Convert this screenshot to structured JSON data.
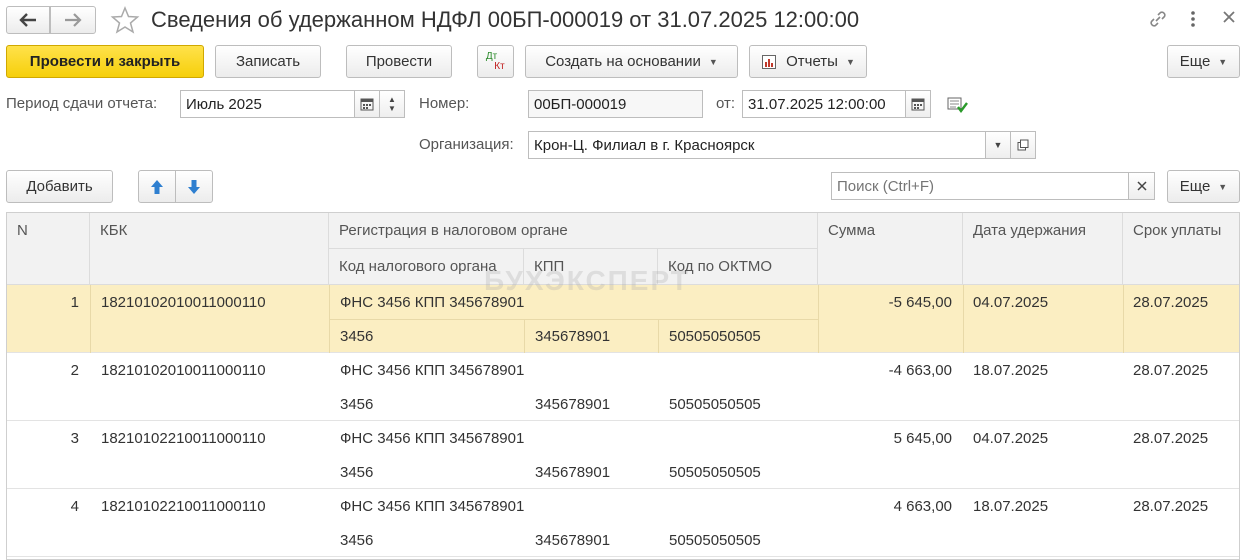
{
  "window": {
    "title": "Сведения об удержанном НДФЛ 00БП-000019 от 31.07.2025 12:00:00",
    "back_icon": "arrow-left-icon",
    "forward_icon": "arrow-right-icon",
    "star_icon": "star-icon",
    "link_icon": "link-icon",
    "menu_icon": "more-vertical-icon",
    "close_icon": "close-icon"
  },
  "toolbar": {
    "post_close": "Провести и закрыть",
    "save": "Записать",
    "post": "Провести",
    "dt_top": "Дт",
    "dt_bottom": "Кт",
    "create_basis": "Создать на основании",
    "reports": "Отчеты",
    "more": "Еще"
  },
  "form": {
    "period_label": "Период сдачи отчета:",
    "period_value": "Июль 2025",
    "number_label": "Номер:",
    "number_value": "00БП-000019",
    "date_label": "от:",
    "date_value": "31.07.2025 12:00:00",
    "org_label": "Организация:",
    "org_value": "Крон-Ц. Филиал в г. Красноярск"
  },
  "table_toolbar": {
    "add": "Добавить",
    "search_placeholder": "Поиск (Ctrl+F)",
    "more": "Еще"
  },
  "table": {
    "headers": {
      "n": "N",
      "kbk": "КБК",
      "reg": "Регистрация в налоговом органе",
      "tax_code": "Код налогового органа",
      "kpp": "КПП",
      "oktmo": "Код по ОКТМО",
      "sum": "Сумма",
      "date_withheld": "Дата удержания",
      "due_date": "Срок уплаты"
    },
    "rows": [
      {
        "n": "1",
        "kbk": "18210102010011000110",
        "reg": "ФНС 3456 КПП 345678901",
        "tax_code": "3456",
        "kpp": "345678901",
        "oktmo": "50505050505",
        "sum": "-5 645,00",
        "date_withheld": "04.07.2025",
        "due_date": "28.07.2025"
      },
      {
        "n": "2",
        "kbk": "18210102010011000110",
        "reg": "ФНС 3456 КПП 345678901",
        "tax_code": "3456",
        "kpp": "345678901",
        "oktmo": "50505050505",
        "sum": "-4 663,00",
        "date_withheld": "18.07.2025",
        "due_date": "28.07.2025"
      },
      {
        "n": "3",
        "kbk": "18210102210011000110",
        "reg": "ФНС 3456 КПП 345678901",
        "tax_code": "3456",
        "kpp": "345678901",
        "oktmo": "50505050505",
        "sum": "5 645,00",
        "date_withheld": "04.07.2025",
        "due_date": "28.07.2025"
      },
      {
        "n": "4",
        "kbk": "18210102210011000110",
        "reg": "ФНС 3456 КПП 345678901",
        "tax_code": "3456",
        "kpp": "345678901",
        "oktmo": "50505050505",
        "sum": "4 663,00",
        "date_withheld": "18.07.2025",
        "due_date": "28.07.2025"
      }
    ]
  },
  "watermark": "БУХЭКСПЕРТ",
  "colors": {
    "primary_button": "#f6cf0b",
    "selected_row": "#fbeec2",
    "header_bg": "#f2f2f2"
  }
}
